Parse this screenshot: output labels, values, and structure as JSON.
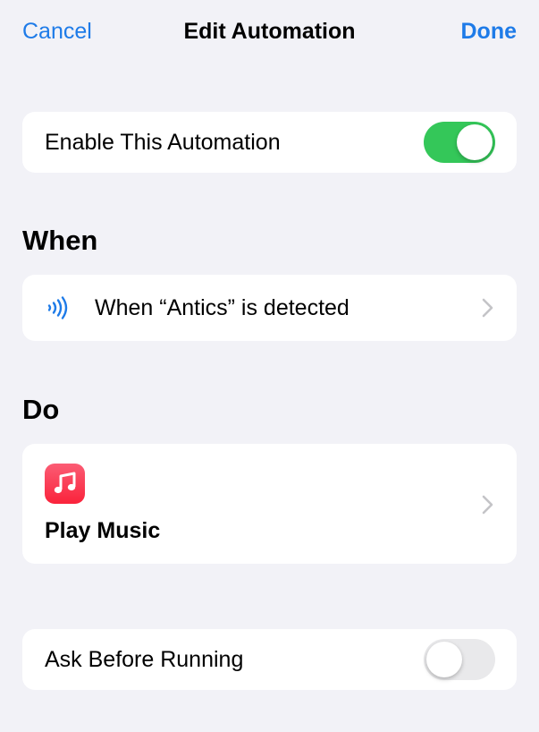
{
  "nav": {
    "cancel_label": "Cancel",
    "title": "Edit Automation",
    "done_label": "Done"
  },
  "enable": {
    "label": "Enable This Automation",
    "on": true
  },
  "when_section": {
    "title": "When",
    "trigger_label": "When “Antics” is detected",
    "trigger_icon": "nfc-wave-icon"
  },
  "do_section": {
    "title": "Do",
    "action_label": "Play Music",
    "action_icon": "music-app-icon"
  },
  "ask": {
    "label": "Ask Before Running",
    "on": false
  },
  "colors": {
    "accent": "#1e7be8",
    "toggle_on": "#34c759",
    "toggle_off": "#e9e9eb",
    "background": "#f2f2f7"
  }
}
